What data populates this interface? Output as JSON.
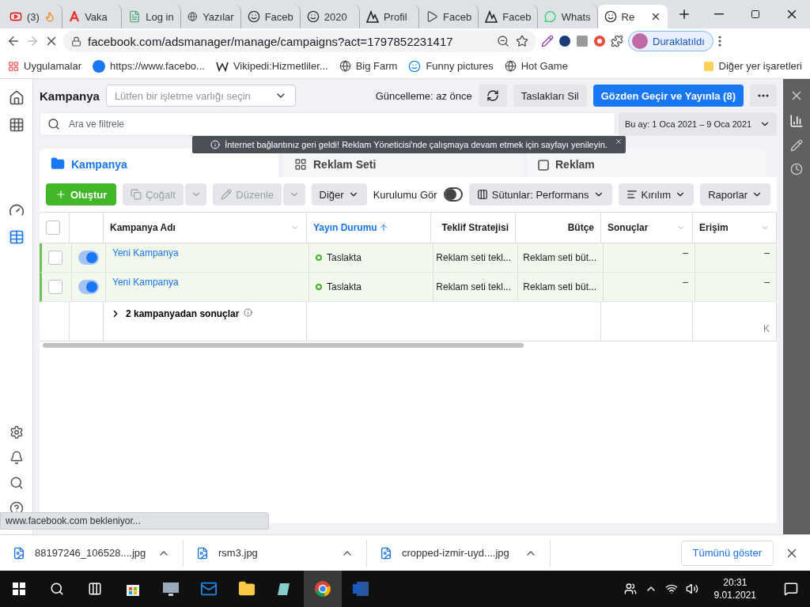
{
  "browser": {
    "tabs": [
      {
        "title": "(3)",
        "kind": "video",
        "selected": false
      },
      {
        "title": "Vaka",
        "kind": "letter",
        "selected": false
      },
      {
        "title": "Log in",
        "kind": "doc",
        "selected": false
      },
      {
        "title": "Yazılar",
        "kind": "globe",
        "selected": false
      },
      {
        "title": "Faceb",
        "kind": "face",
        "selected": false
      },
      {
        "title": "2020",
        "kind": "face",
        "selected": false
      },
      {
        "title": "Profil",
        "kind": "mark",
        "selected": false
      },
      {
        "title": "Faceb",
        "kind": "play",
        "selected": false
      },
      {
        "title": "Faceb",
        "kind": "mark",
        "selected": false
      },
      {
        "title": "Whats",
        "kind": "chat",
        "selected": false
      },
      {
        "title": "Re",
        "kind": "face",
        "selected": true
      }
    ],
    "address": "facebook.com/adsmanager/manage/campaigns?act=1797852231417",
    "profile": "Duraklatıldı",
    "bookmarks": [
      {
        "label": "Uygulamalar",
        "kind": "apps"
      },
      {
        "label": "https://www.facebo...",
        "kind": "fb"
      },
      {
        "label": "Vikipedi:Hizmetliler...",
        "kind": "wiki"
      },
      {
        "label": "Big Farm",
        "kind": "globe"
      },
      {
        "label": "Funny pictures",
        "kind": "smile"
      },
      {
        "label": "Hot Game",
        "kind": "globe"
      }
    ],
    "other_bookmarks": "Diğer yer işaretleri"
  },
  "app": {
    "title": "Kampanya",
    "business_select": {
      "placeholder": "Lütfen bir işletme varlığı seçin"
    },
    "updated": "Güncelleme: az önce",
    "discard": "Taslakları Sil",
    "publish": "Gözden Geçir ve Yayınla (8)",
    "search": {
      "placeholder": "Ara ve filtrele"
    },
    "date_range": "Bu ay: 1 Oca 2021 – 9 Oca 2021",
    "toast": "İnternet bağlantınız geri geldi! Reklam Yöneticisi'nde çalışmaya devam etmek için sayfayı yenileyin.",
    "level_tabs": [
      {
        "label": "Kampanya",
        "selected": true
      },
      {
        "label": "Reklam Seti",
        "selected": false
      },
      {
        "label": "Reklam",
        "selected": false
      }
    ],
    "toolbar": {
      "create": "Oluştur",
      "duplicate": {
        "label": "Çoğalt",
        "disabled": true
      },
      "edit": {
        "label": "Düzenle",
        "disabled": true
      },
      "more": "Diğer",
      "setup": {
        "label": "Kurulumu Gör",
        "on": false
      },
      "columns": "Sütunlar: Performans",
      "breakdown": "Kırılım",
      "reports": "Raporlar"
    },
    "table": {
      "select_all": {
        "checked": false
      },
      "columns": [
        {
          "label": "Kampanya Adı",
          "sorted": false
        },
        {
          "label": "Yayın Durumu",
          "sorted": true
        },
        {
          "label": "Teklif Stratejisi",
          "sorted": false
        },
        {
          "label": "Bütçe",
          "sorted": false
        },
        {
          "label": "Sonuçlar",
          "sorted": false
        },
        {
          "label": "Erişim",
          "sorted": false
        }
      ],
      "rows": [
        {
          "checked": false,
          "on": true,
          "draft": true,
          "name": "Yeni Kampanya",
          "status": "Taslakta",
          "bid": "Reklam seti tekl...",
          "budget": "Reklam seti büt...",
          "results": "–",
          "reach": "–"
        },
        {
          "checked": false,
          "on": true,
          "draft": true,
          "name": "Yeni Kampanya",
          "status": "Taslakta",
          "bid": "Reklam seti tekl...",
          "budget": "Reklam seti büt...",
          "results": "–",
          "reach": "–"
        }
      ],
      "footer": {
        "label": "2 kampanyadan sonuçlar",
        "reach": "K"
      }
    }
  },
  "status_text": "www.facebook.com bekleniyor...",
  "downloads": [
    "88197246_106528....jpg",
    "rsm3.jpg",
    "cropped-izmir-uyd....jpg"
  ],
  "show_all": "Tümünü göster",
  "taskbar": {
    "time": "20:31",
    "date": "9.01.2021"
  }
}
